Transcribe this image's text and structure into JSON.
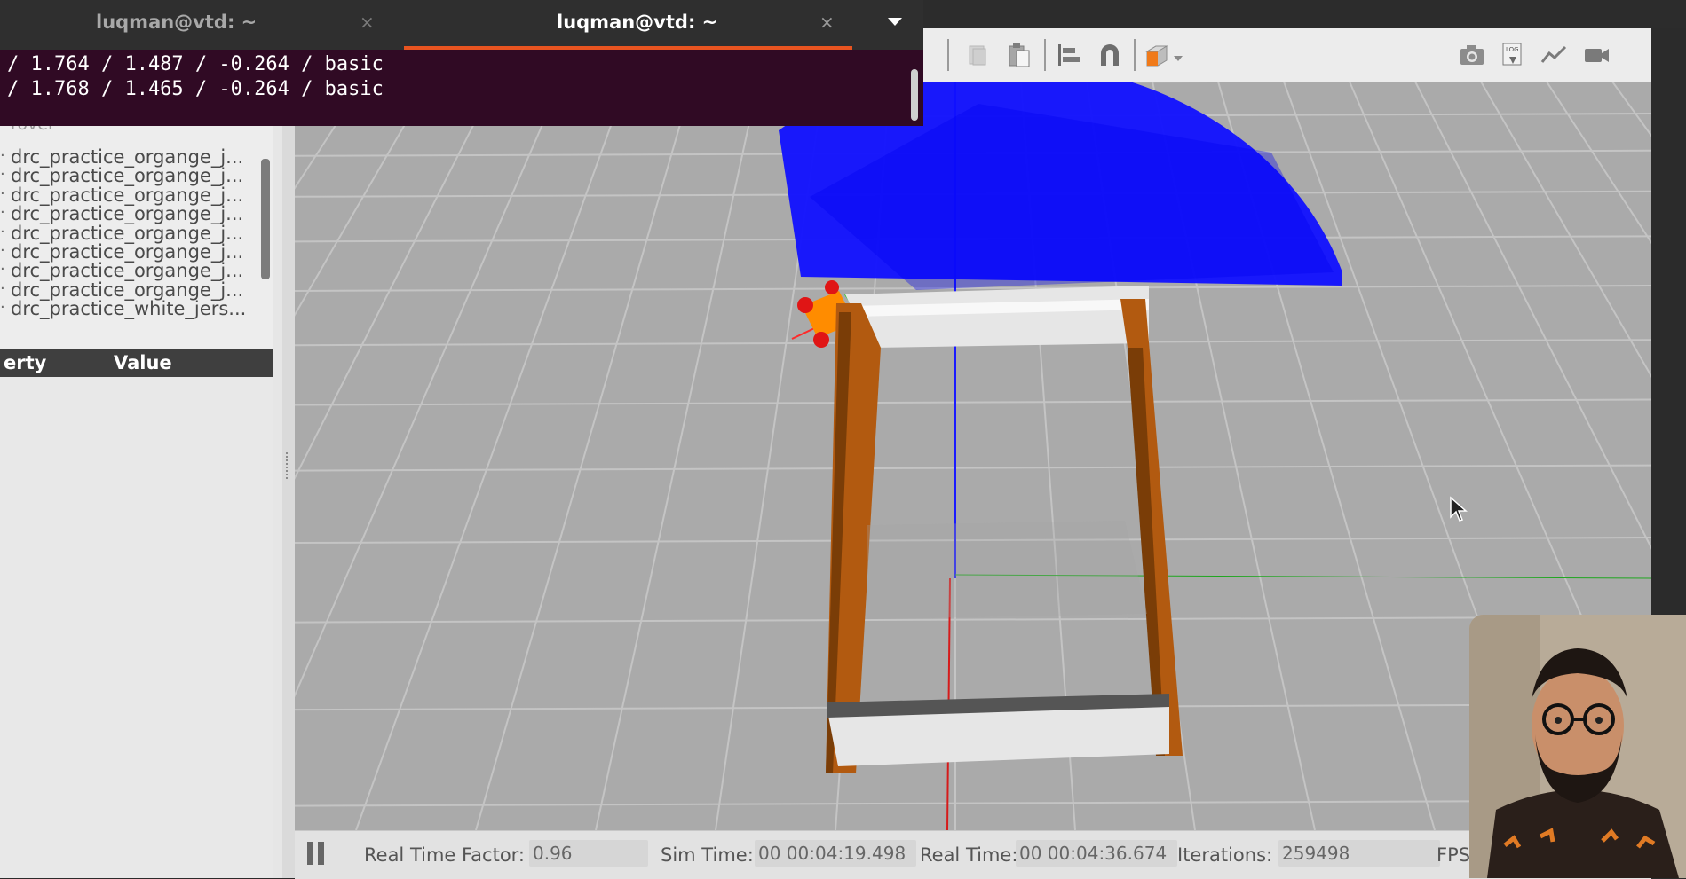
{
  "terminal": {
    "tabs": [
      {
        "title": "luqman@vtd: ~",
        "active": false
      },
      {
        "title": "luqman@vtd: ~",
        "active": true
      }
    ],
    "close_glyph": "×",
    "lines": [
      "/ 1.764 / 1.487 / -0.264 / basic",
      "/ 1.768 / 1.465 / -0.264 / basic"
    ],
    "colors": {
      "background": "#300a24",
      "accent": "#e95420"
    }
  },
  "left_panel": {
    "partial_item": "rover",
    "models": [
      "drc_practice_organge_j...",
      "drc_practice_organge_j...",
      "drc_practice_organge_j...",
      "drc_practice_organge_j...",
      "drc_practice_organge_j...",
      "drc_practice_organge_j...",
      "drc_practice_organge_j...",
      "drc_practice_organge_j...",
      "drc_practice_white_jers..."
    ],
    "property_header": "erty",
    "value_header": "Value"
  },
  "toolbar": {
    "icons": [
      "copy-icon",
      "paste-icon",
      "align-icon",
      "snap-icon",
      "view-angle-icon",
      "screenshot-icon",
      "log-icon",
      "plot-icon",
      "record-video-icon"
    ],
    "log_text": "LOG"
  },
  "status_bar": {
    "real_time_factor_label": "Real Time Factor:",
    "real_time_factor": "0.96",
    "sim_time_label": "Sim Time:",
    "sim_time": "00 00:04:19.498",
    "real_time_label": "Real Time:",
    "real_time": "00 00:04:36.674",
    "iterations_label": "Iterations:",
    "iterations": "259498",
    "fps_label": "FPS"
  },
  "scene": {
    "ground_color": "#aaaaaa",
    "grid_color": "#c4c4c4",
    "laser_color": "#1010ff",
    "wall_wood_color": "#b25a10",
    "wall_white_color": "#e6e6e6",
    "robot_color": "#ff8c00"
  }
}
